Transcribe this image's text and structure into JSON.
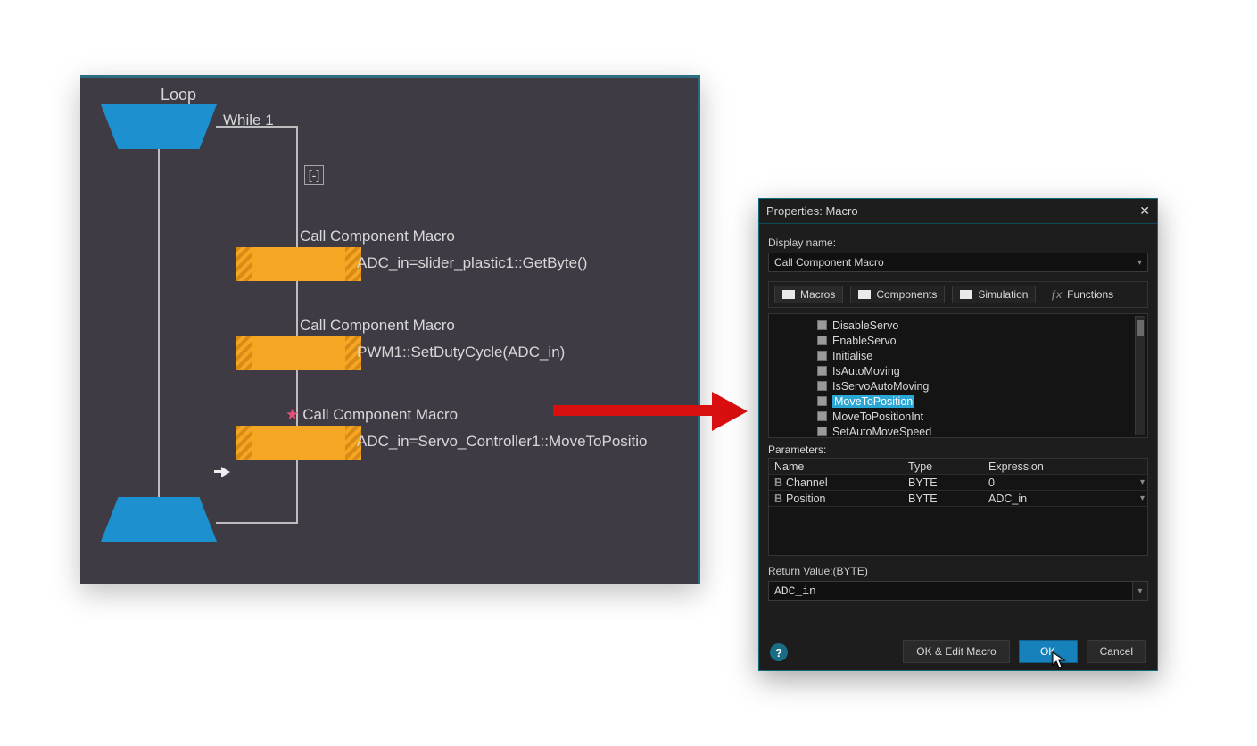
{
  "flowchart": {
    "loop_label": "Loop",
    "while_label": "While 1",
    "collapse_token": "[-]",
    "blocks": [
      {
        "title": "Call Component Macro",
        "sub": "ADC_in=slider_plastic1::GetByte()"
      },
      {
        "title": "Call Component Macro",
        "sub": "PWM1::SetDutyCycle(ADC_in)"
      },
      {
        "title": "Call Component Macro",
        "sub": "ADC_in=Servo_Controller1::MoveToPositio",
        "starred": true
      }
    ]
  },
  "dialog": {
    "title": "Properties: Macro",
    "display_name_label": "Display name:",
    "display_name_value": "Call Component Macro",
    "tabs": {
      "macros": "Macros",
      "components": "Components",
      "simulation": "Simulation",
      "functions": "Functions"
    },
    "tree_items": [
      "DisableServo",
      "EnableServo",
      "Initialise",
      "IsAutoMoving",
      "IsServoAutoMoving",
      "MoveToPosition",
      "MoveToPositionInt",
      "SetAutoMoveSpeed"
    ],
    "tree_selected_index": 5,
    "parameters_label": "Parameters:",
    "params_header": {
      "name": "Name",
      "type": "Type",
      "expression": "Expression"
    },
    "params": [
      {
        "name": "Channel",
        "type": "BYTE",
        "expression": "0"
      },
      {
        "name": "Position",
        "type": "BYTE",
        "expression": "ADC_in"
      }
    ],
    "return_label": "Return Value:(BYTE)",
    "return_value": "ADC_in",
    "buttons": {
      "ok_edit": "OK & Edit Macro",
      "ok": "OK",
      "cancel": "Cancel"
    }
  }
}
